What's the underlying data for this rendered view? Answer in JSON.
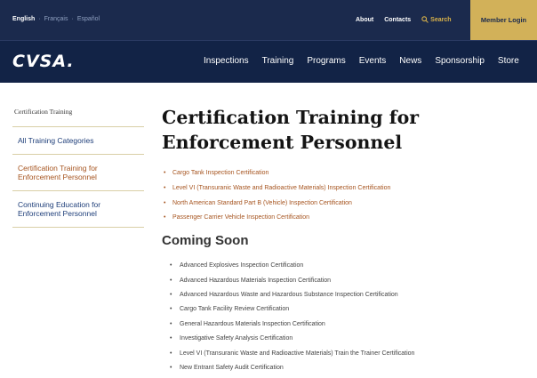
{
  "topbar": {
    "languages": [
      "English",
      "Français",
      "Español"
    ],
    "separator": "·",
    "about": "About",
    "contacts": "Contacts",
    "search": "Search",
    "member_login": "Member Login"
  },
  "logo": "CVSA.",
  "nav": [
    "Inspections",
    "Training",
    "Programs",
    "Events",
    "News",
    "Sponsorship",
    "Store"
  ],
  "sidebar": {
    "heading": "Certification Training",
    "items": [
      {
        "label": "All Training Categories"
      },
      {
        "label": "Certification Training for Enforcement Personnel"
      },
      {
        "label": "Continuing Education for Enforcement Personnel"
      }
    ]
  },
  "main": {
    "title": "Certification Training for Enforcement Personnel",
    "certs": [
      "Cargo Tank Inspection Certification",
      "Level VI (Transuranic Waste and Radioactive Materials) Inspection Certification",
      "North American Standard Part B (Vehicle) Inspection Certification",
      "Passenger Carrier Vehicle Inspection Certification"
    ],
    "coming_soon_heading": "Coming Soon",
    "coming_soon": [
      "Advanced Explosives Inspection Certification",
      "Advanced Hazardous Materials Inspection Certification",
      "Advanced Hazardous Waste and Hazardous Substance Inspection Certification",
      "Cargo Tank Facility Review Certification",
      "General Hazardous Materials Inspection Certification",
      "Investigative Safety Analysis Certification",
      "Level VI (Transuranic Waste and Radioactive Materials) Train the Trainer Certification",
      "New Entrant Safety Audit Certification"
    ]
  },
  "colors": {
    "header_bg": "#1b2a4d",
    "nav_bg": "#122346",
    "member_bg": "#d2b159",
    "link": "#a6541f",
    "sidebar_link": "#1e3e79"
  }
}
